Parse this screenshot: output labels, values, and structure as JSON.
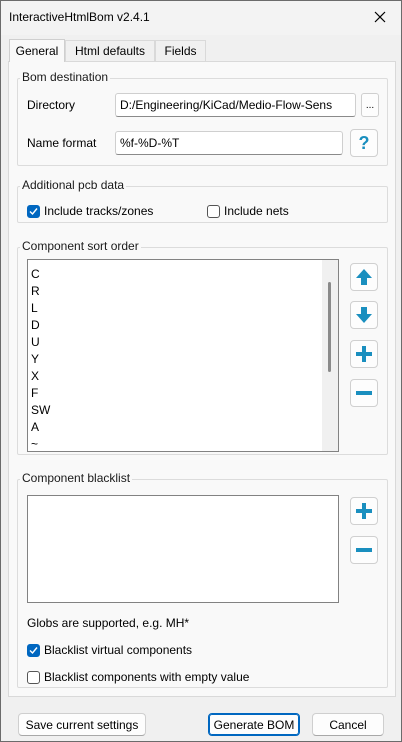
{
  "window": {
    "title": "InteractiveHtmlBom v2.4.1"
  },
  "tabs": [
    {
      "label": "General",
      "active": true
    },
    {
      "label": "Html defaults",
      "active": false
    },
    {
      "label": "Fields",
      "active": false
    }
  ],
  "bom_destination": {
    "group_label": "Bom destination",
    "directory_label": "Directory",
    "directory_value": "D:/Engineering/KiCad/Medio-Flow-Sens",
    "browse_label": "...",
    "name_format_label": "Name format",
    "name_format_value": "%f-%D-%T",
    "help_label": "?"
  },
  "additional_pcb_data": {
    "group_label": "Additional pcb data",
    "include_tracks": {
      "label": "Include tracks/zones",
      "checked": true
    },
    "include_nets": {
      "label": "Include nets",
      "checked": false
    }
  },
  "sort_order": {
    "group_label": "Component sort order",
    "items": [
      "C",
      "R",
      "L",
      "D",
      "U",
      "Y",
      "X",
      "F",
      "SW",
      "A",
      "~"
    ]
  },
  "blacklist": {
    "group_label": "Component blacklist",
    "items": [],
    "hint": "Globs are supported, e.g. MH*",
    "blacklist_virtual": {
      "label": "Blacklist virtual components",
      "checked": true
    },
    "blacklist_empty": {
      "label": "Blacklist components with empty value",
      "checked": false
    }
  },
  "footer": {
    "save_label": "Save current settings",
    "generate_label": "Generate BOM",
    "cancel_label": "Cancel"
  },
  "colors": {
    "accent": "#0067c0",
    "icon_blue": "#1a8fbf"
  }
}
